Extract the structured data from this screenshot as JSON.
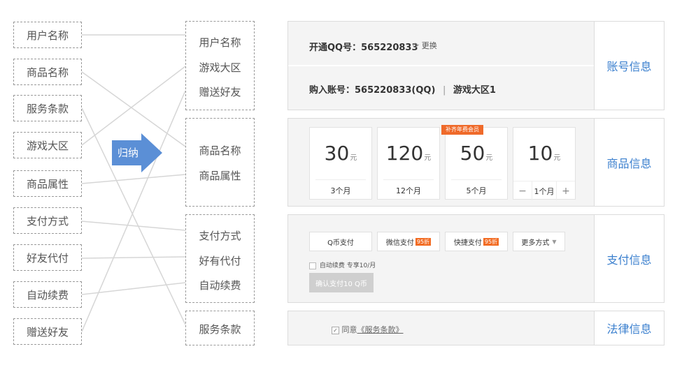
{
  "left_items": [
    "用户名称",
    "商品名称",
    "服务条款",
    "游戏大区",
    "商品属性",
    "支付方式",
    "好友代付",
    "自动续费",
    "赠送好友"
  ],
  "groups": [
    {
      "items": [
        "用户名称",
        "游戏大区",
        "赠送好友"
      ]
    },
    {
      "items": [
        "商品名称",
        "商品属性"
      ]
    },
    {
      "items": [
        "支付方式",
        "好有代付",
        "自动续费"
      ]
    },
    {
      "items": [
        "服务条款"
      ]
    }
  ],
  "arrow_label": "归纳",
  "account": {
    "qq_label": "开通QQ号：565220833",
    "change": "更换",
    "buy_label": "购入账号：565220833(QQ)",
    "sep": "|",
    "region": "游戏大区1",
    "side": "账号信息"
  },
  "product": {
    "cards": [
      {
        "amount": "30",
        "unit": "元",
        "duration": "3个月"
      },
      {
        "amount": "120",
        "unit": "元",
        "duration": "12个月"
      },
      {
        "amount": "50",
        "unit": "元",
        "duration": "5个月",
        "badge": "补齐年费会员"
      },
      {
        "amount": "10",
        "unit": "元",
        "stepper_value": "1个月",
        "minus": "−",
        "plus": "+"
      }
    ],
    "side": "商品信息"
  },
  "payment": {
    "methods": [
      {
        "label": "Q币支付"
      },
      {
        "label": "微信支付",
        "tag": "95折"
      },
      {
        "label": "快捷支付",
        "tag": "95折"
      },
      {
        "label": "更多方式",
        "caret": "▼"
      }
    ],
    "auto_renew": "自动续费 专享10/月",
    "confirm": "确认支付10 Q币",
    "side": "支付信息"
  },
  "legal": {
    "agree_prefix": "同意",
    "terms": "《服务条款》",
    "side": "法律信息"
  },
  "colors": {
    "accent": "#3a7fce",
    "arrow": "#5b8fd6",
    "badge": "#ef6a2a"
  }
}
